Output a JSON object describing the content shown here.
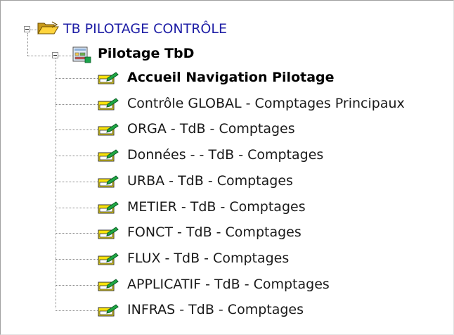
{
  "tree": {
    "root": {
      "label": "TB PILOTAGE CONTRÔLE",
      "icon": "open-folder-icon",
      "expanded": true
    },
    "group": {
      "label": "Pilotage TbD",
      "icon": "dashboard-icon",
      "expanded": true
    },
    "items": [
      {
        "label": "Accueil Navigation Pilotage",
        "bold": true,
        "icon": "form-edit-icon"
      },
      {
        "label": "Contrôle GLOBAL - Comptages Principaux",
        "icon": "form-edit-icon"
      },
      {
        "label": "ORGA - TdB - Comptages",
        "icon": "form-edit-icon"
      },
      {
        "label": "Données - - TdB - Comptages",
        "icon": "form-edit-icon"
      },
      {
        "label": "URBA - TdB - Comptages",
        "icon": "form-edit-icon"
      },
      {
        "label": "METIER - TdB - Comptages",
        "icon": "form-edit-icon"
      },
      {
        "label": "FONCT - TdB - Comptages",
        "icon": "form-edit-icon"
      },
      {
        "label": "FLUX - TdB - Comptages",
        "icon": "form-edit-icon"
      },
      {
        "label": "APPLICATIF - TdB - Comptages",
        "icon": "form-edit-icon"
      },
      {
        "label": "INFRAS - TdB - Comptages",
        "icon": "form-edit-icon"
      }
    ]
  }
}
